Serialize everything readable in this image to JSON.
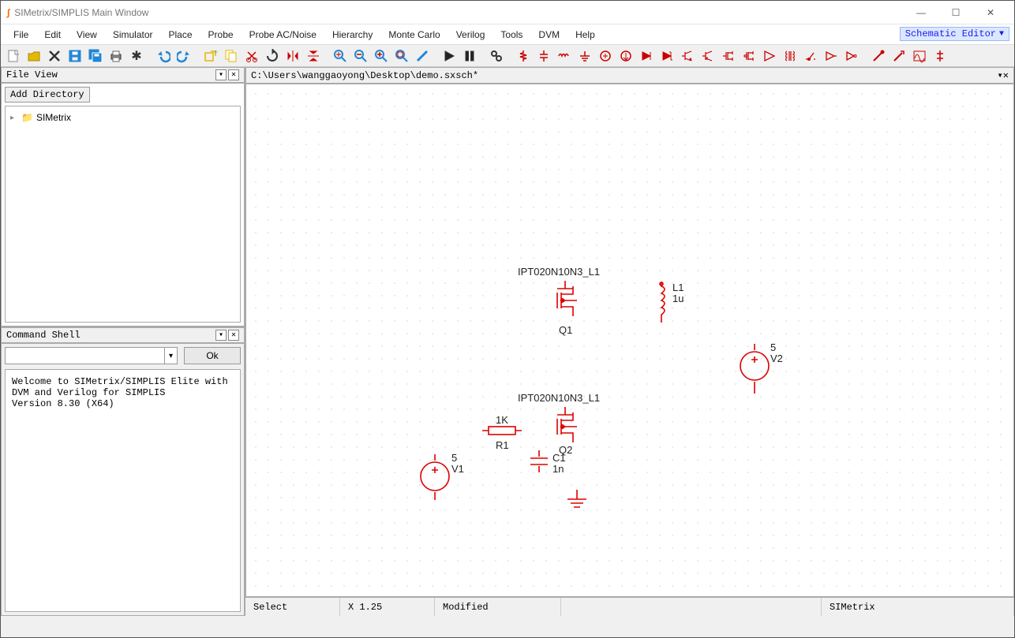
{
  "window": {
    "title": "SIMetrix/SIMPLIS Main Window"
  },
  "menu": [
    "File",
    "Edit",
    "View",
    "Simulator",
    "Place",
    "Probe",
    "Probe AC/Noise",
    "Hierarchy",
    "Monte Carlo",
    "Verilog",
    "Tools",
    "DVM",
    "Help"
  ],
  "mode_pill": "Schematic Editor",
  "file_view": {
    "title": "File View",
    "add_dir": "Add Directory",
    "root_item": "SIMetrix"
  },
  "command_shell": {
    "title": "Command Shell",
    "ok": "Ok",
    "welcome": "Welcome to SIMetrix/SIMPLIS Elite with\nDVM and Verilog for SIMPLIS\nVersion 8.30 (X64)"
  },
  "document": {
    "path": "C:\\Users\\wanggaoyong\\Desktop\\demo.sxsch*"
  },
  "schematic": {
    "q1_model": "IPT020N10N3_L1",
    "q1_ref": "Q1",
    "q2_model": "IPT020N10N3_L1",
    "q2_ref": "Q2",
    "r1_val": "1K",
    "r1_ref": "R1",
    "c1_ref": "C1",
    "c1_val": "1n",
    "l1_ref": "L1",
    "l1_val": "1u",
    "v1_val": "5",
    "v1_ref": "V1",
    "v2_val": "5",
    "v2_ref": "V2"
  },
  "status": {
    "mode": "Select",
    "zoom": "X 1.25",
    "modified": "Modified",
    "simulator": "SIMetrix"
  }
}
